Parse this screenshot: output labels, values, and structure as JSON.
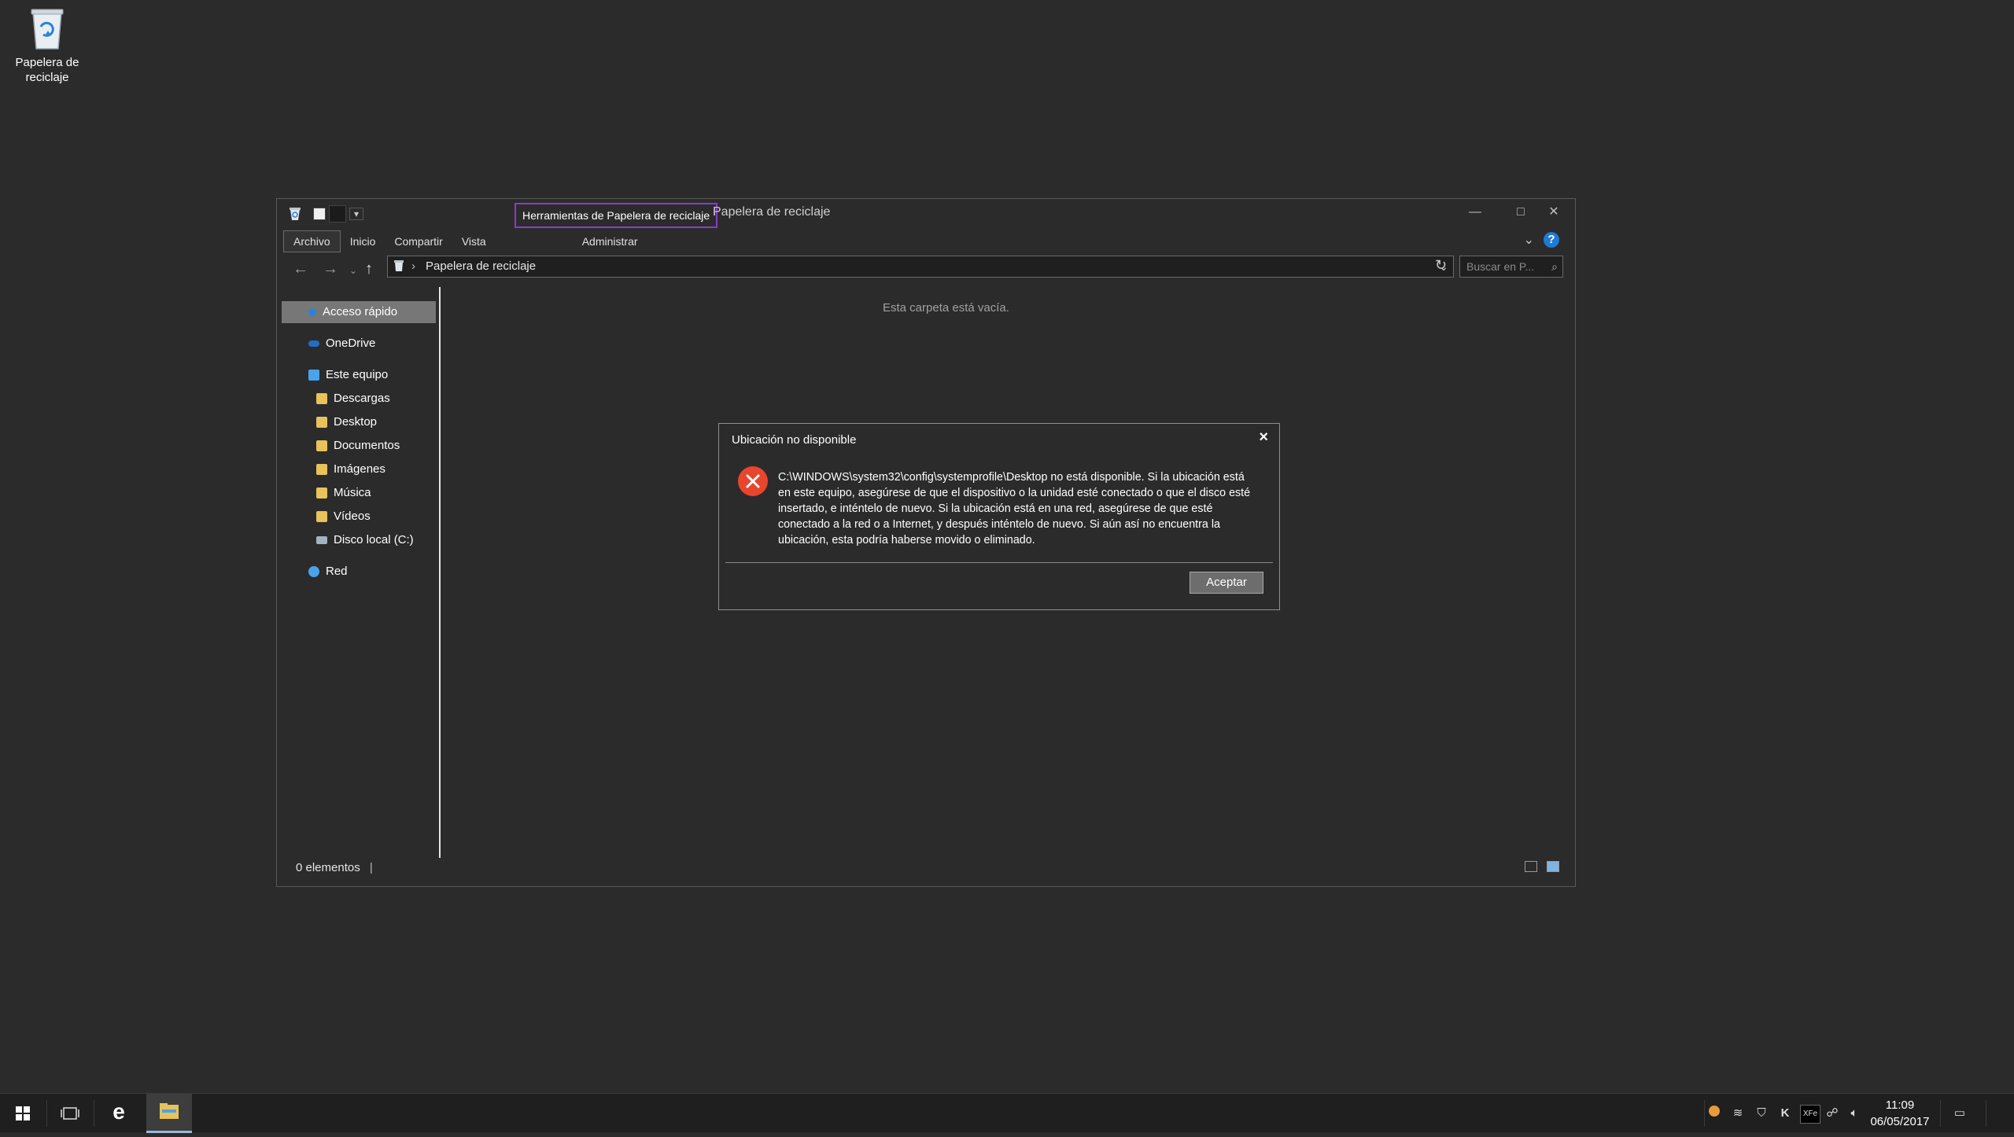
{
  "desktop": {
    "recycle_bin_label_1": "Papelera de",
    "recycle_bin_label_2": "reciclaje"
  },
  "explorer": {
    "tools_tab": "Herramientas de Papelera de reciclaje",
    "title": "Papelera de reciclaje",
    "ribbon_tabs": [
      "Archivo",
      "Inicio",
      "Compartir",
      "Vista",
      "Administrar"
    ],
    "address": "Papelera de reciclaje",
    "search_placeholder": "Buscar en P...",
    "nav": {
      "quick_access": "Acceso rápido",
      "onedrive": "OneDrive",
      "this_pc": "Este equipo",
      "downloads": "Descargas",
      "desktop": "Desktop",
      "documents": "Documentos",
      "images": "Imágenes",
      "music": "Música",
      "videos": "Vídeos",
      "local_disk": "Disco local (C:)",
      "network": "Red"
    },
    "empty_message": "Esta carpeta está vacía.",
    "status": "0 elementos"
  },
  "dialog": {
    "title": "Ubicación no disponible",
    "message": "C:\\WINDOWS\\system32\\config\\systemprofile\\Desktop no está disponible. Si la ubicación está en este equipo, asegúrese de que el dispositivo o la unidad esté conectado o que el disco esté insertado, e inténtelo de nuevo. Si la ubicación está en una red, asegúrese de que esté conectado a la red o a Internet, y después inténtelo de nuevo. Si aún así no encuentra la ubicación, esta podría haberse movido o eliminado.",
    "ok_label": "Aceptar"
  },
  "taskbar": {
    "time": "11:09",
    "date": "06/05/2017",
    "tray_label_xfce": "XFe"
  },
  "colors": {
    "background": "#2b2b2b",
    "accent_highlight": "#8a3cc8",
    "error_red": "#e8462c",
    "help_blue": "#1f7ad6"
  },
  "icons": [
    "recycle-bin-icon",
    "error-icon",
    "help-icon",
    "folder-icon",
    "start-icon",
    "edge-icon",
    "file-explorer-icon"
  ]
}
